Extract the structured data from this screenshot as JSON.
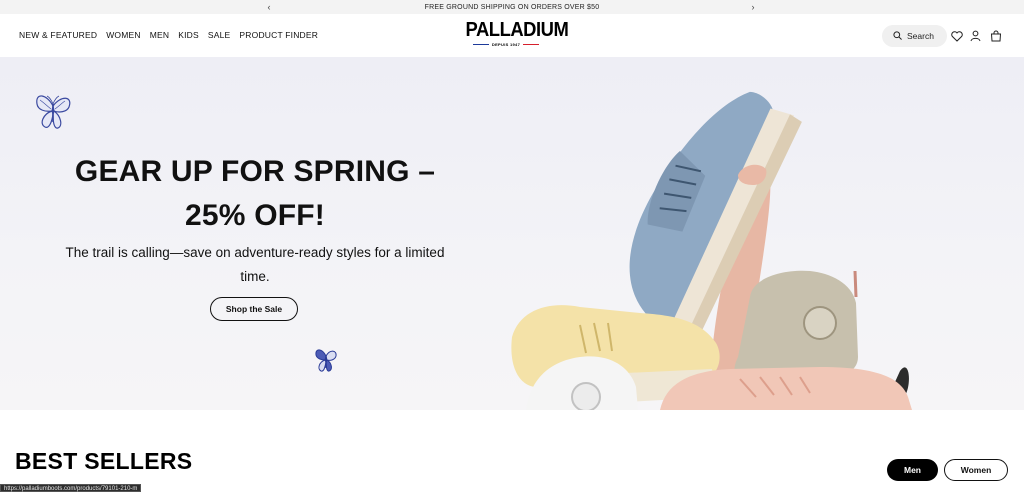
{
  "announcement": {
    "message": "FREE GROUND SHIPPING ON ORDERS OVER $50",
    "prev_label": "‹",
    "next_label": "›"
  },
  "header": {
    "nav": [
      "NEW & FEATURED",
      "WOMEN",
      "MEN",
      "KIDS",
      "SALE",
      "PRODUCT FINDER"
    ],
    "logo": {
      "word": "PALLADIUM",
      "tagline": "DEPUIS 1947"
    },
    "search_label": "Search",
    "icons": [
      "search-icon",
      "heart-icon",
      "account-icon",
      "bag-icon"
    ]
  },
  "hero": {
    "title_line1": "GEAR UP FOR SPRING –",
    "title_line2": "25% OFF!",
    "subtitle_line1": "The trail is calling—save on adventure-ready styles for a limited",
    "subtitle_line2": "time.",
    "cta_label": "Shop the Sale",
    "image": "hand holding blue sneaker above pile of yellow, white, beige and pink boots"
  },
  "best_sellers": {
    "title": "BEST SELLERS",
    "tabs": [
      {
        "label": "Men",
        "active": true
      },
      {
        "label": "Women",
        "active": false
      }
    ]
  },
  "status_bar": {
    "url": "https://palladiumboots.com/products/79101-210-m"
  },
  "colors": {
    "announce_bg": "#f3f3f3",
    "hero_bg": "#eeeef5",
    "logo_blue": "#1d3a9a",
    "logo_red": "#d61f2c",
    "butterfly": "#3b4aa0",
    "active_tab": "#000000"
  }
}
